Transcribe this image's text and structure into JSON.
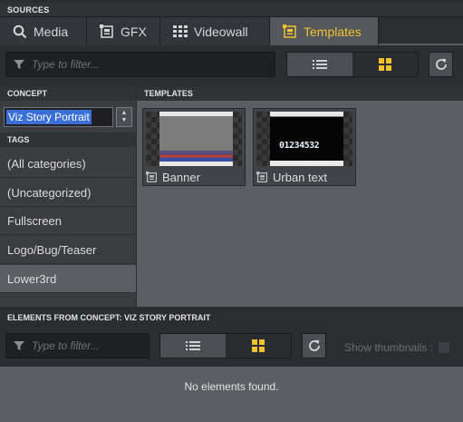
{
  "sources_header": "SOURCES",
  "tabs": [
    {
      "label": "Media",
      "icon": "search-icon"
    },
    {
      "label": "GFX",
      "icon": "gfx-icon"
    },
    {
      "label": "Videowall",
      "icon": "grid-icon"
    },
    {
      "label": "Templates",
      "icon": "template-icon",
      "active": true
    }
  ],
  "top_filter": {
    "placeholder": "Type to filter..."
  },
  "concept": {
    "header": "CONCEPT",
    "selected": "Viz Story Portrait"
  },
  "tags": {
    "header": "TAGS",
    "items": [
      {
        "label": "(All categories)"
      },
      {
        "label": "(Uncategorized)"
      },
      {
        "label": "Fullscreen"
      },
      {
        "label": "Logo/Bug/Teaser"
      },
      {
        "label": "Lower3rd",
        "selected": true
      }
    ]
  },
  "templates": {
    "header": "TEMPLATES",
    "items": [
      {
        "name": "Banner"
      },
      {
        "name": "Urban text",
        "preview_text": "01234532"
      }
    ]
  },
  "elements": {
    "header": "ELEMENTS FROM CONCEPT: VIZ STORY PORTRAIT",
    "filter_placeholder": "Type to filter...",
    "show_thumbnails_label": "Show thumbnails :",
    "empty_message": "No elements found."
  },
  "colors": {
    "accent": "#f2c12e",
    "selection": "#3a6fd8"
  }
}
